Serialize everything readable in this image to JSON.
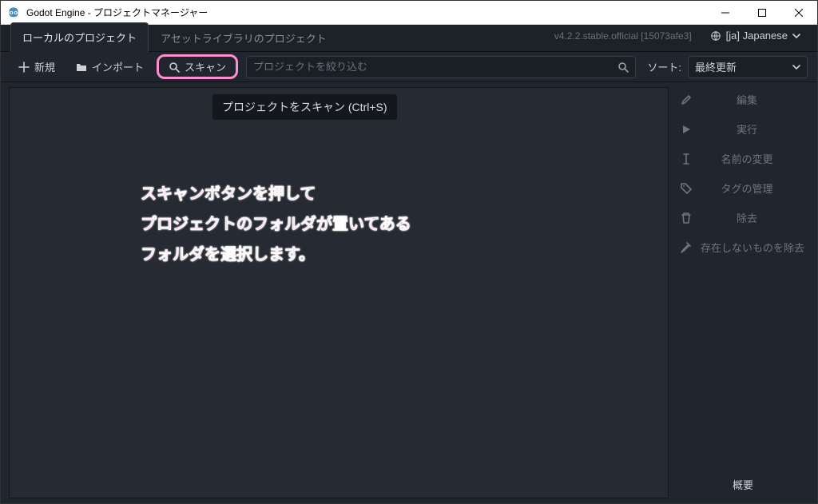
{
  "window": {
    "title": "Godot Engine - プロジェクトマネージャー"
  },
  "tabs": {
    "local": "ローカルのプロジェクト",
    "assetlib": "アセットライブラリのプロジェクト"
  },
  "version": "v4.2.2.stable.official [15073afe3]",
  "language": {
    "label": "[ja] Japanese"
  },
  "toolbar": {
    "new": "新規",
    "import": "インポート",
    "scan": "スキャン"
  },
  "search": {
    "placeholder": "プロジェクトを絞り込む"
  },
  "sort": {
    "label": "ソート:",
    "selected": "最終更新"
  },
  "tooltip": "プロジェクトをスキャン (Ctrl+S)",
  "annotation": {
    "line1": "スキャンボタンを押して",
    "line2": "プロジェクトのフォルダが置いてある",
    "line3": "フォルダを選択します。"
  },
  "side": {
    "edit": "編集",
    "run": "実行",
    "rename": "名前の変更",
    "tags": "タグの管理",
    "remove": "除去",
    "remove_missing": "存在しないものを除去",
    "overview": "概要"
  }
}
